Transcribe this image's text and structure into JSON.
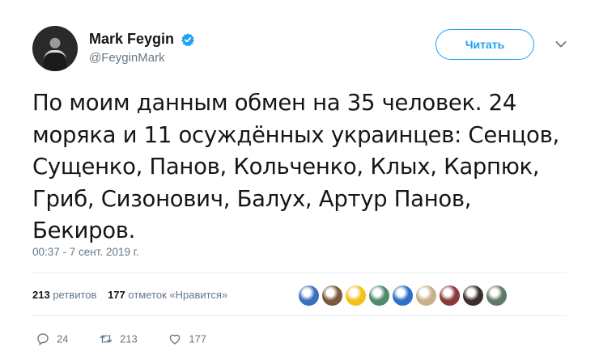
{
  "author": {
    "display_name": "Mark Feygin",
    "handle": "@FeyginMark",
    "verified": true
  },
  "follow_button_label": "Читать",
  "tweet": {
    "text": "По моим данным обмен на 35 человек. 24 моряка и 11 осуждённых украинцев: Сенцов, Сущенко, Панов, Кольченко, Клых, Карпюк, Гриб, Сизонович, Балух, Артур Панов, Бекиров.",
    "timestamp": "00:37 - 7 сент. 2019 г."
  },
  "stats": {
    "retweets_count": "213",
    "retweets_label": "ретвитов",
    "likes_count": "177",
    "likes_label": "отметок «Нравится»"
  },
  "likers": [
    {
      "color": "#3b6fbf"
    },
    {
      "color": "#7a5a3a"
    },
    {
      "color": "#f2c21b"
    },
    {
      "color": "#4f8a6c"
    },
    {
      "color": "#2f6fc8"
    },
    {
      "color": "#c9b08a"
    },
    {
      "color": "#8a3a3a"
    },
    {
      "color": "#3a2e2e"
    },
    {
      "color": "#5e7a66"
    }
  ],
  "actions": {
    "replies_count": "24",
    "retweets_count": "213",
    "likes_count": "177"
  },
  "colors": {
    "accent": "#1da1f2",
    "text": "#14171a",
    "muted": "#657786"
  },
  "icons": [
    "verified-icon",
    "chevron-down-icon",
    "reply-icon",
    "retweet-icon",
    "like-icon"
  ]
}
